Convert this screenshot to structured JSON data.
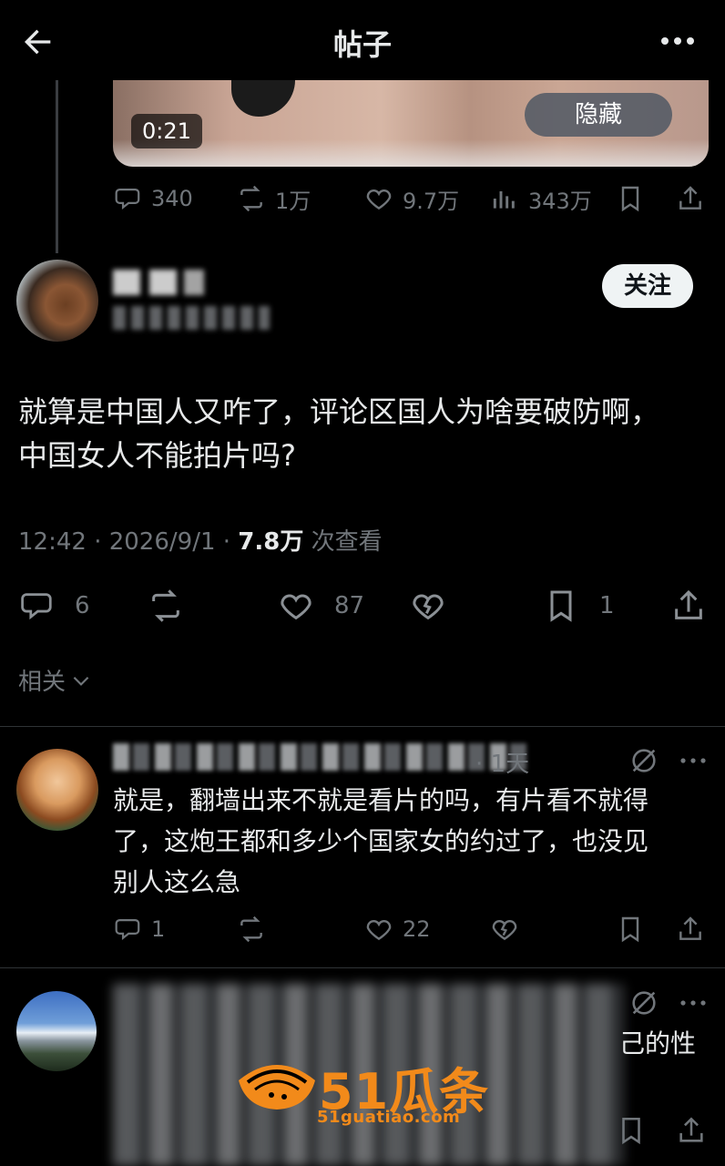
{
  "header": {
    "title": "帖子"
  },
  "quoted_post": {
    "video_time": "0:21",
    "hide_label": "隐藏",
    "actions": {
      "replies": "340",
      "reposts": "1万",
      "likes": "9.7万",
      "views": "343万"
    }
  },
  "post": {
    "follow_label": "关注",
    "text_line1": "就算是中国人又咋了，评论区国人为啥要破防啊，",
    "text_line2": "中国女人不能拍片吗?",
    "time_date": "12:42 · 2026/9/1 · ",
    "view_count": "7.8万",
    "views_suffix": " 次查看",
    "actions": {
      "replies": "6",
      "likes": "87",
      "bookmarks": "1"
    }
  },
  "related_label": "相关",
  "replies": [
    {
      "time": "· 1天",
      "text_lines": [
        "就是，翻墙出来不就是看片的吗，有片看不就得",
        "了，这炮王都和多少个国家女的约过了，也没见",
        "别人这么急"
      ],
      "actions": {
        "replies": "1",
        "likes": "22"
      }
    },
    {
      "visible_tail": "己的性"
    }
  ],
  "watermark": {
    "main": "51瓜条",
    "sub": "51guatiao.com"
  },
  "colors": {
    "background": "#000000",
    "text": "#e7e9ea",
    "muted": "#71767b",
    "divider": "#2f3336",
    "watermark": "#f28a1a"
  }
}
